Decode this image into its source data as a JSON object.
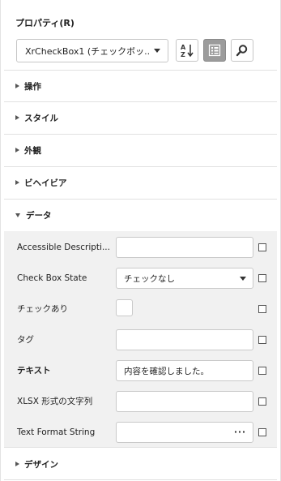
{
  "panel": {
    "title": "プロパティ(R)",
    "object_selector": {
      "value": "XrCheckBox1 (チェックボッ..."
    },
    "toolbar": {
      "sort_icon": "sort-alphabetical-icon",
      "categorized_icon": "categorized-view-icon",
      "search_icon": "search-icon"
    }
  },
  "sections": {
    "actions": "操作",
    "style": "スタイル",
    "appearance": "外観",
    "behavior": "ビヘイビア",
    "data": "データ",
    "design": "デザイン"
  },
  "data_rows": [
    {
      "label": "Accessible Descripti...",
      "value": ""
    },
    {
      "label": "Check Box State",
      "value": "チェックなし"
    },
    {
      "label": "チェックあり",
      "value": ""
    },
    {
      "label": "タグ",
      "value": ""
    },
    {
      "label": "テキスト",
      "value": "内容を確認しました。"
    },
    {
      "label": "XLSX 形式の文字列",
      "value": ""
    },
    {
      "label": "Text Format String",
      "value": "",
      "button": "···"
    }
  ],
  "colors": {
    "active_button": "#9b9b9b",
    "data_background": "#f1f1f1"
  }
}
